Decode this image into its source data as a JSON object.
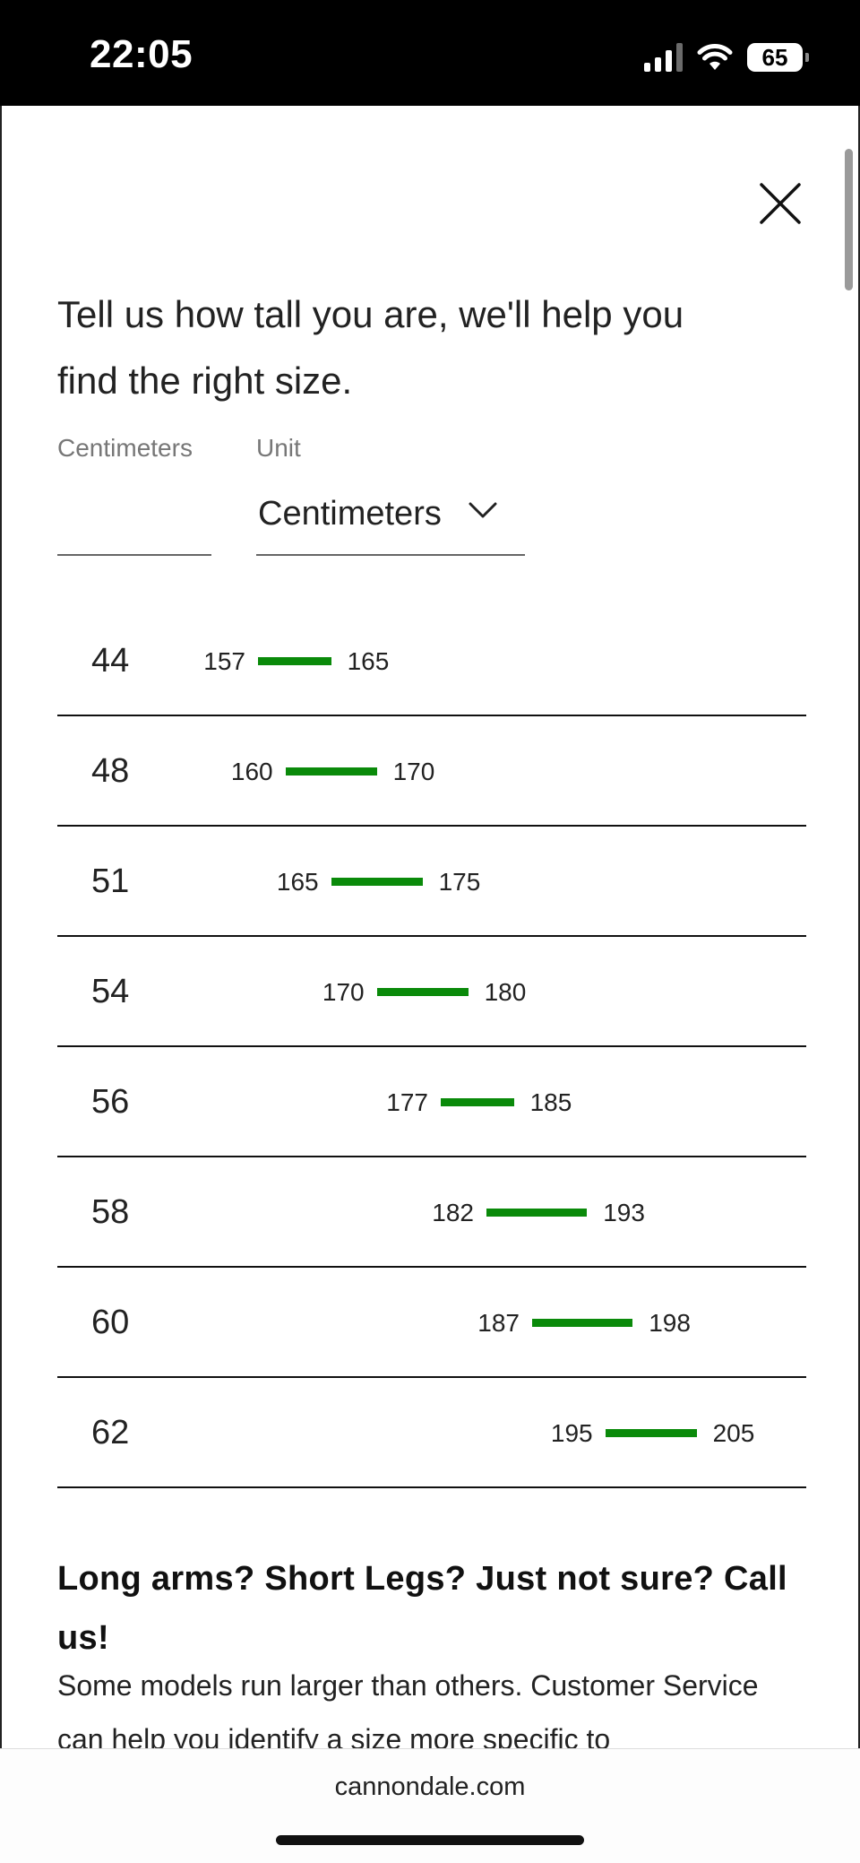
{
  "status_bar": {
    "time": "22:05",
    "battery": "65"
  },
  "modal": {
    "intro": "Tell us how tall you are, we'll help you find the right size.",
    "height_field": {
      "label": "Centimeters",
      "value": ""
    },
    "unit_field": {
      "label": "Unit",
      "value": "Centimeters"
    }
  },
  "size_chart": {
    "bar_color": "#0a8a0a",
    "rows": [
      {
        "size": "44",
        "min": "157",
        "max": "165"
      },
      {
        "size": "48",
        "min": "160",
        "max": "170"
      },
      {
        "size": "51",
        "min": "165",
        "max": "175"
      },
      {
        "size": "54",
        "min": "170",
        "max": "180"
      },
      {
        "size": "56",
        "min": "177",
        "max": "185"
      },
      {
        "size": "58",
        "min": "182",
        "max": "193"
      },
      {
        "size": "60",
        "min": "187",
        "max": "198"
      },
      {
        "size": "62",
        "min": "195",
        "max": "205"
      }
    ]
  },
  "help": {
    "title": "Long arms? Short Legs? Just not sure? Call us!",
    "body": "Some models run larger than others. Customer Service can help you identify a size more specific to"
  },
  "browser": {
    "url": "cannondale.com"
  }
}
